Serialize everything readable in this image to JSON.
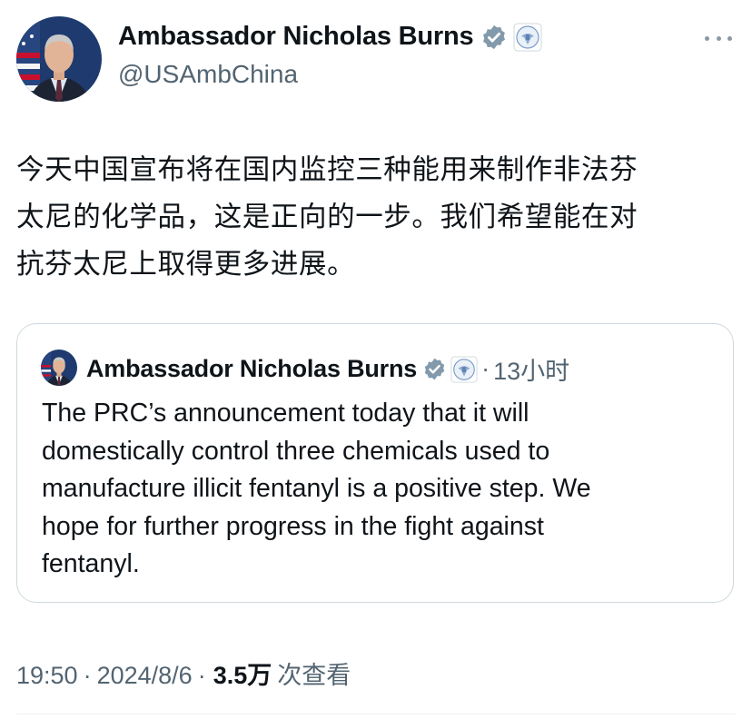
{
  "author": {
    "display_name": "Ambassador Nicholas Burns",
    "handle": "@USAmbChina"
  },
  "tweet": {
    "text_lines": [
      "今天中国宣布将在国内监控三种能用来制作非法芬",
      "太尼的化学品，这是正向的一步。我们希望能在对",
      "抗芬太尼上取得更多进展。"
    ]
  },
  "quoted": {
    "display_name": "Ambassador Nicholas Burns",
    "separator": "·",
    "time_ago": "13小时",
    "text_lines": [
      "The PRC’s announcement today that it will",
      "domestically control three chemicals used to",
      "manufacture illicit fentanyl is a positive step.  We",
      "hope for further progress in the fight against",
      "fentanyl."
    ]
  },
  "meta": {
    "time": "19:50",
    "date": "2024/8/6",
    "views_count": "3.5万",
    "views_label": "次查看",
    "separator": "·"
  },
  "icons": {
    "verified": "verified-badge-icon",
    "affiliation": "us-seal-icon",
    "more": "more-options-icon"
  },
  "colors": {
    "verified_gray": "#829aab",
    "secondary_text": "#536471",
    "border": "#cfd9de"
  }
}
